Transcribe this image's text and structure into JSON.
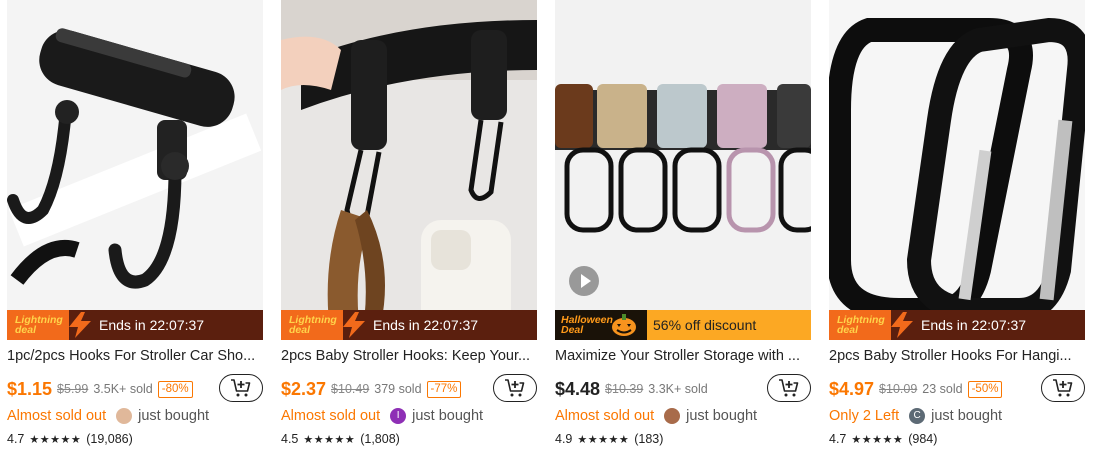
{
  "colors": {
    "accent": "#fb7701",
    "lightning_bg": "#5b1f0e",
    "halloween_bg": "#fca823"
  },
  "products": [
    {
      "title": "1pc/2pcs Hooks For Stroller Car Sho...",
      "banner_type": "lightning",
      "badge_line1": "Lightning",
      "badge_line2": "deal",
      "banner_text": "Ends in 22:07:37",
      "price": "$1.15",
      "original_price": "$5.99",
      "sold": "3.5K+ sold",
      "discount_pct": "-80%",
      "urgency": "Almost sold out",
      "buyer_initial": "",
      "bought_text": "just bought",
      "rating": "4.7",
      "stars": "★★★★★",
      "review_count": "(19,086)"
    },
    {
      "title": "2pcs Baby Stroller Hooks: Keep Your...",
      "banner_type": "lightning",
      "badge_line1": "Lightning",
      "badge_line2": "deal",
      "banner_text": "Ends in 22:07:37",
      "price": "$2.37",
      "original_price": "$10.49",
      "sold": "379 sold",
      "discount_pct": "-77%",
      "urgency": "Almost sold out",
      "buyer_initial": "I",
      "bought_text": "just bought",
      "rating": "4.5",
      "stars": "★★★★★",
      "review_count": "(1,808)"
    },
    {
      "title": "Maximize Your Stroller Storage with ...",
      "banner_type": "halloween",
      "badge_line1": "Halloween",
      "badge_line2": "Deal",
      "banner_text": "56% off discount",
      "price": "$4.48",
      "original_price": "$10.39",
      "sold": "3.3K+ sold",
      "discount_pct": "",
      "urgency": "Almost sold out",
      "buyer_initial": "",
      "bought_text": "just bought",
      "rating": "4.9",
      "stars": "★★★★★",
      "review_count": "(183)"
    },
    {
      "title": "2pcs Baby Stroller Hooks For Hangi...",
      "banner_type": "lightning",
      "badge_line1": "Lightning",
      "badge_line2": "deal",
      "banner_text": "Ends in 22:07:37",
      "price": "$4.97",
      "original_price": "$10.09",
      "sold": "23 sold",
      "discount_pct": "-50%",
      "urgency": "Only 2 Left",
      "buyer_initial": "C",
      "bought_text": "just bought",
      "rating": "4.7",
      "stars": "★★★★★",
      "review_count": "(984)"
    }
  ]
}
